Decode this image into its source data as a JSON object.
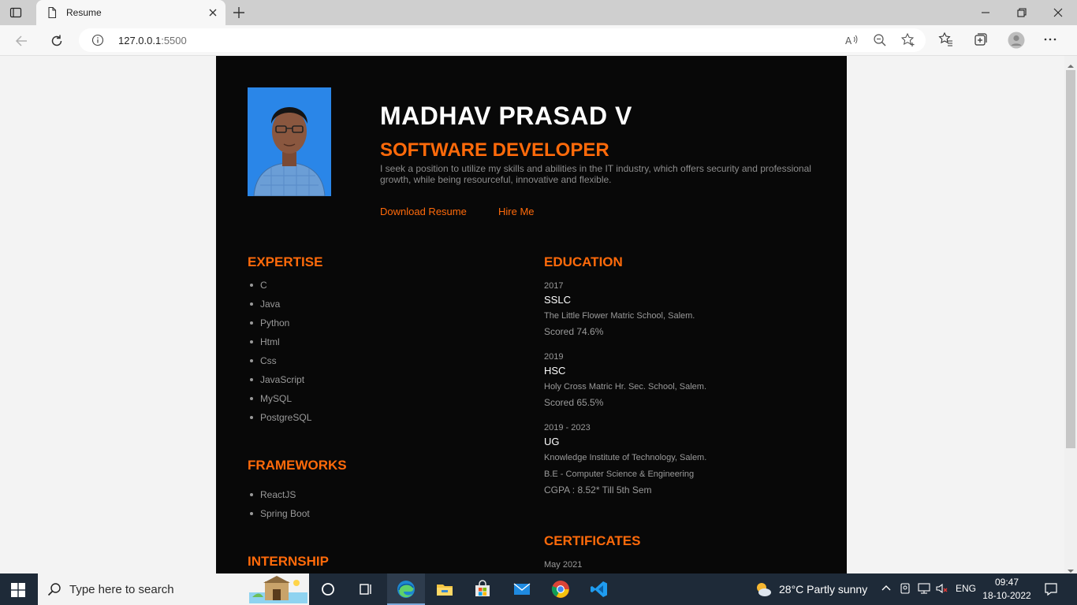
{
  "browser": {
    "tab_title": "Resume",
    "url_host": "127.0.0.1",
    "url_port": ":5500"
  },
  "resume": {
    "name": "MADHAV PRASAD V",
    "role": "SOFTWARE DEVELOPER",
    "objective": "I seek a position to utilize my skills and abilities in the IT industry, which offers security and professional growth, while being resourceful, innovative and flexible.",
    "download_label": "Download Resume",
    "hire_label": "Hire Me",
    "expertise_title": "EXPERTISE",
    "expertise": [
      "C",
      "Java",
      "Python",
      "Html",
      "Css",
      "JavaScript",
      "MySQL",
      "PostgreSQL"
    ],
    "frameworks_title": "FRAMEWORKS",
    "frameworks": [
      "ReactJS",
      "Spring Boot"
    ],
    "internship_title": "INTERNSHIP",
    "education_title": "EDUCATION",
    "education": [
      {
        "year": "2017",
        "degree": "SSLC",
        "school": "The Little Flower Matric School, Salem.",
        "score": "Scored 74.6%"
      },
      {
        "year": "2019",
        "degree": "HSC",
        "school": "Holy Cross Matric Hr. Sec. School, Salem.",
        "score": "Scored 65.5%"
      },
      {
        "year": "2019 - 2023",
        "degree": "UG",
        "school": "Knowledge Institute of Technology, Salem.",
        "course": "B.E - Computer Science & Engineering",
        "score": "CGPA : 8.52* Till 5th Sem"
      }
    ],
    "certificates_title": "CERTIFICATES",
    "certificate_first_date": "May 2021"
  },
  "taskbar": {
    "search_placeholder": "Type here to search",
    "weather": "28°C  Partly sunny",
    "language": "ENG",
    "time": "09:47",
    "date": "18-10-2022"
  }
}
